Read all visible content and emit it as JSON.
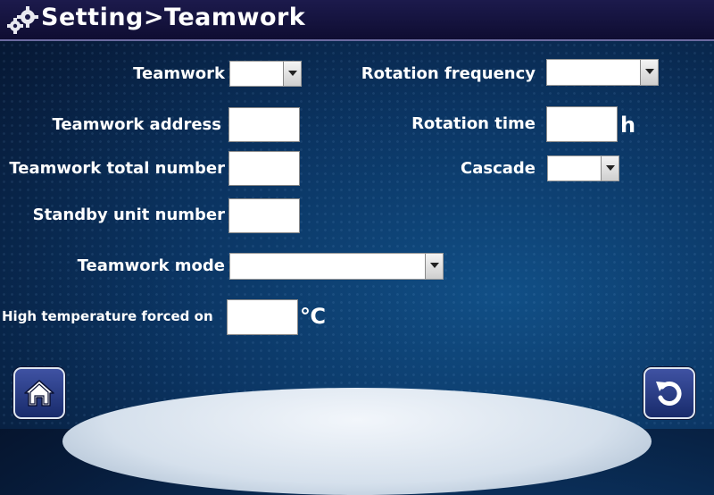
{
  "header": {
    "title": "Setting>Teamwork",
    "icon": "gears-icon"
  },
  "fields": {
    "teamwork": {
      "label": "Teamwork",
      "value": ""
    },
    "teamwork_address": {
      "label": "Teamwork address",
      "value": ""
    },
    "teamwork_total_number": {
      "label": "Teamwork total number",
      "value": ""
    },
    "standby_unit_number": {
      "label": "Standby unit number",
      "value": ""
    },
    "teamwork_mode": {
      "label": "Teamwork mode",
      "value": ""
    },
    "high_temperature_forced_on": {
      "label": "High temperature forced on",
      "value": "",
      "unit": "℃"
    },
    "rotation_frequency": {
      "label": "Rotation frequency",
      "value": ""
    },
    "rotation_time": {
      "label": "Rotation time",
      "value": "",
      "unit": "h"
    },
    "cascade": {
      "label": "Cascade",
      "value": ""
    }
  },
  "nav": {
    "home_icon": "home-icon",
    "back_icon": "back-icon"
  }
}
